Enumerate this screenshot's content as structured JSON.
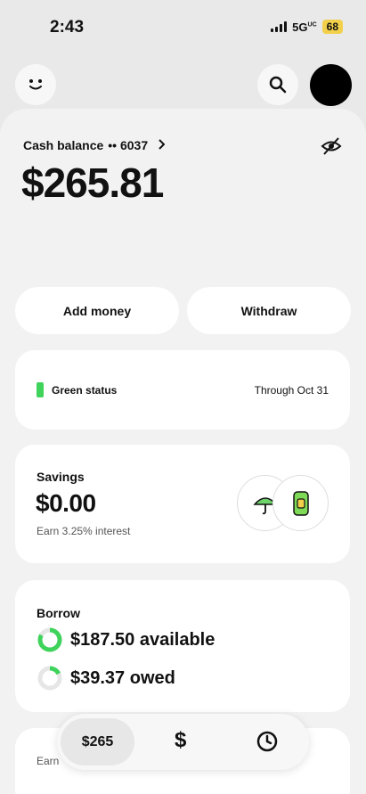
{
  "status_bar": {
    "time": "2:43",
    "network": "5G",
    "network_sup": "UC",
    "battery": "68"
  },
  "topbar": {
    "profile_icon": "smiley-icon",
    "search_icon": "search-icon",
    "avatar": "avatar"
  },
  "balance": {
    "label": "Cash balance",
    "masked": "•• 6037",
    "amount": "$265.81"
  },
  "actions": {
    "add_money": "Add money",
    "withdraw": "Withdraw"
  },
  "status_card": {
    "label": "Green status",
    "through": "Through Oct 31",
    "accent": "#3fd35b"
  },
  "savings": {
    "title": "Savings",
    "amount": "$0.00",
    "interest": "Earn 3.25% interest"
  },
  "borrow": {
    "title": "Borrow",
    "available": "$187.50 available",
    "owed": "$39.37 owed"
  },
  "partial_card": {
    "label": "Earn"
  },
  "nav": {
    "balance_tab": "$265",
    "pay_tab": "$"
  }
}
